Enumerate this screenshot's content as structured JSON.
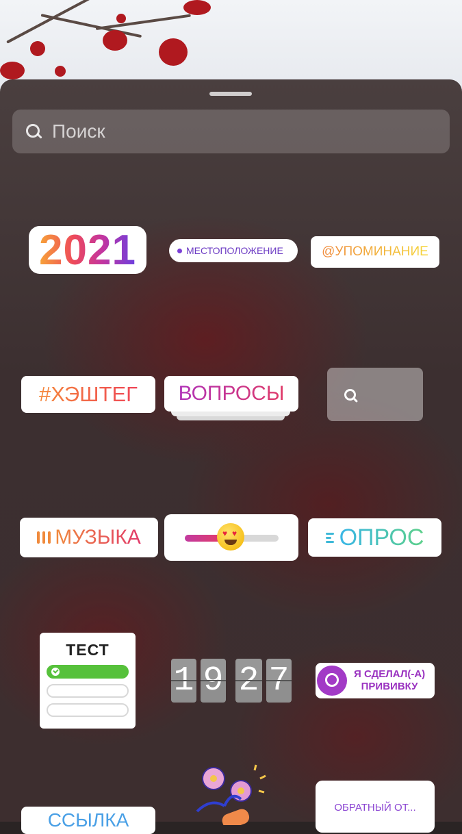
{
  "search": {
    "placeholder": "Поиск"
  },
  "stickers": {
    "year": "2021",
    "location": "МЕСТОПОЛОЖЕНИЕ",
    "mention": "@УПОМИНАНИЕ",
    "hashtag": "#ХЭШТЕГ",
    "questions": "ВОПРОСЫ",
    "music": "МУЗЫКА",
    "poll": "ОПРОС",
    "quiz": {
      "title": "ТЕСТ"
    },
    "countdown_digits": [
      "1",
      "9",
      "2",
      "7"
    ],
    "vaccine": {
      "line1": "Я СДЕЛАЛ(-А)",
      "line2": "ПРИВИВКУ"
    },
    "link": "ССЫЛКА",
    "feedback": "ОБРАТНЫЙ ОТ..."
  },
  "colors": {
    "sheet_background": "#3d2e2f",
    "accent_purple": "#7b3fd6",
    "quiz_correct": "#56c13b"
  }
}
